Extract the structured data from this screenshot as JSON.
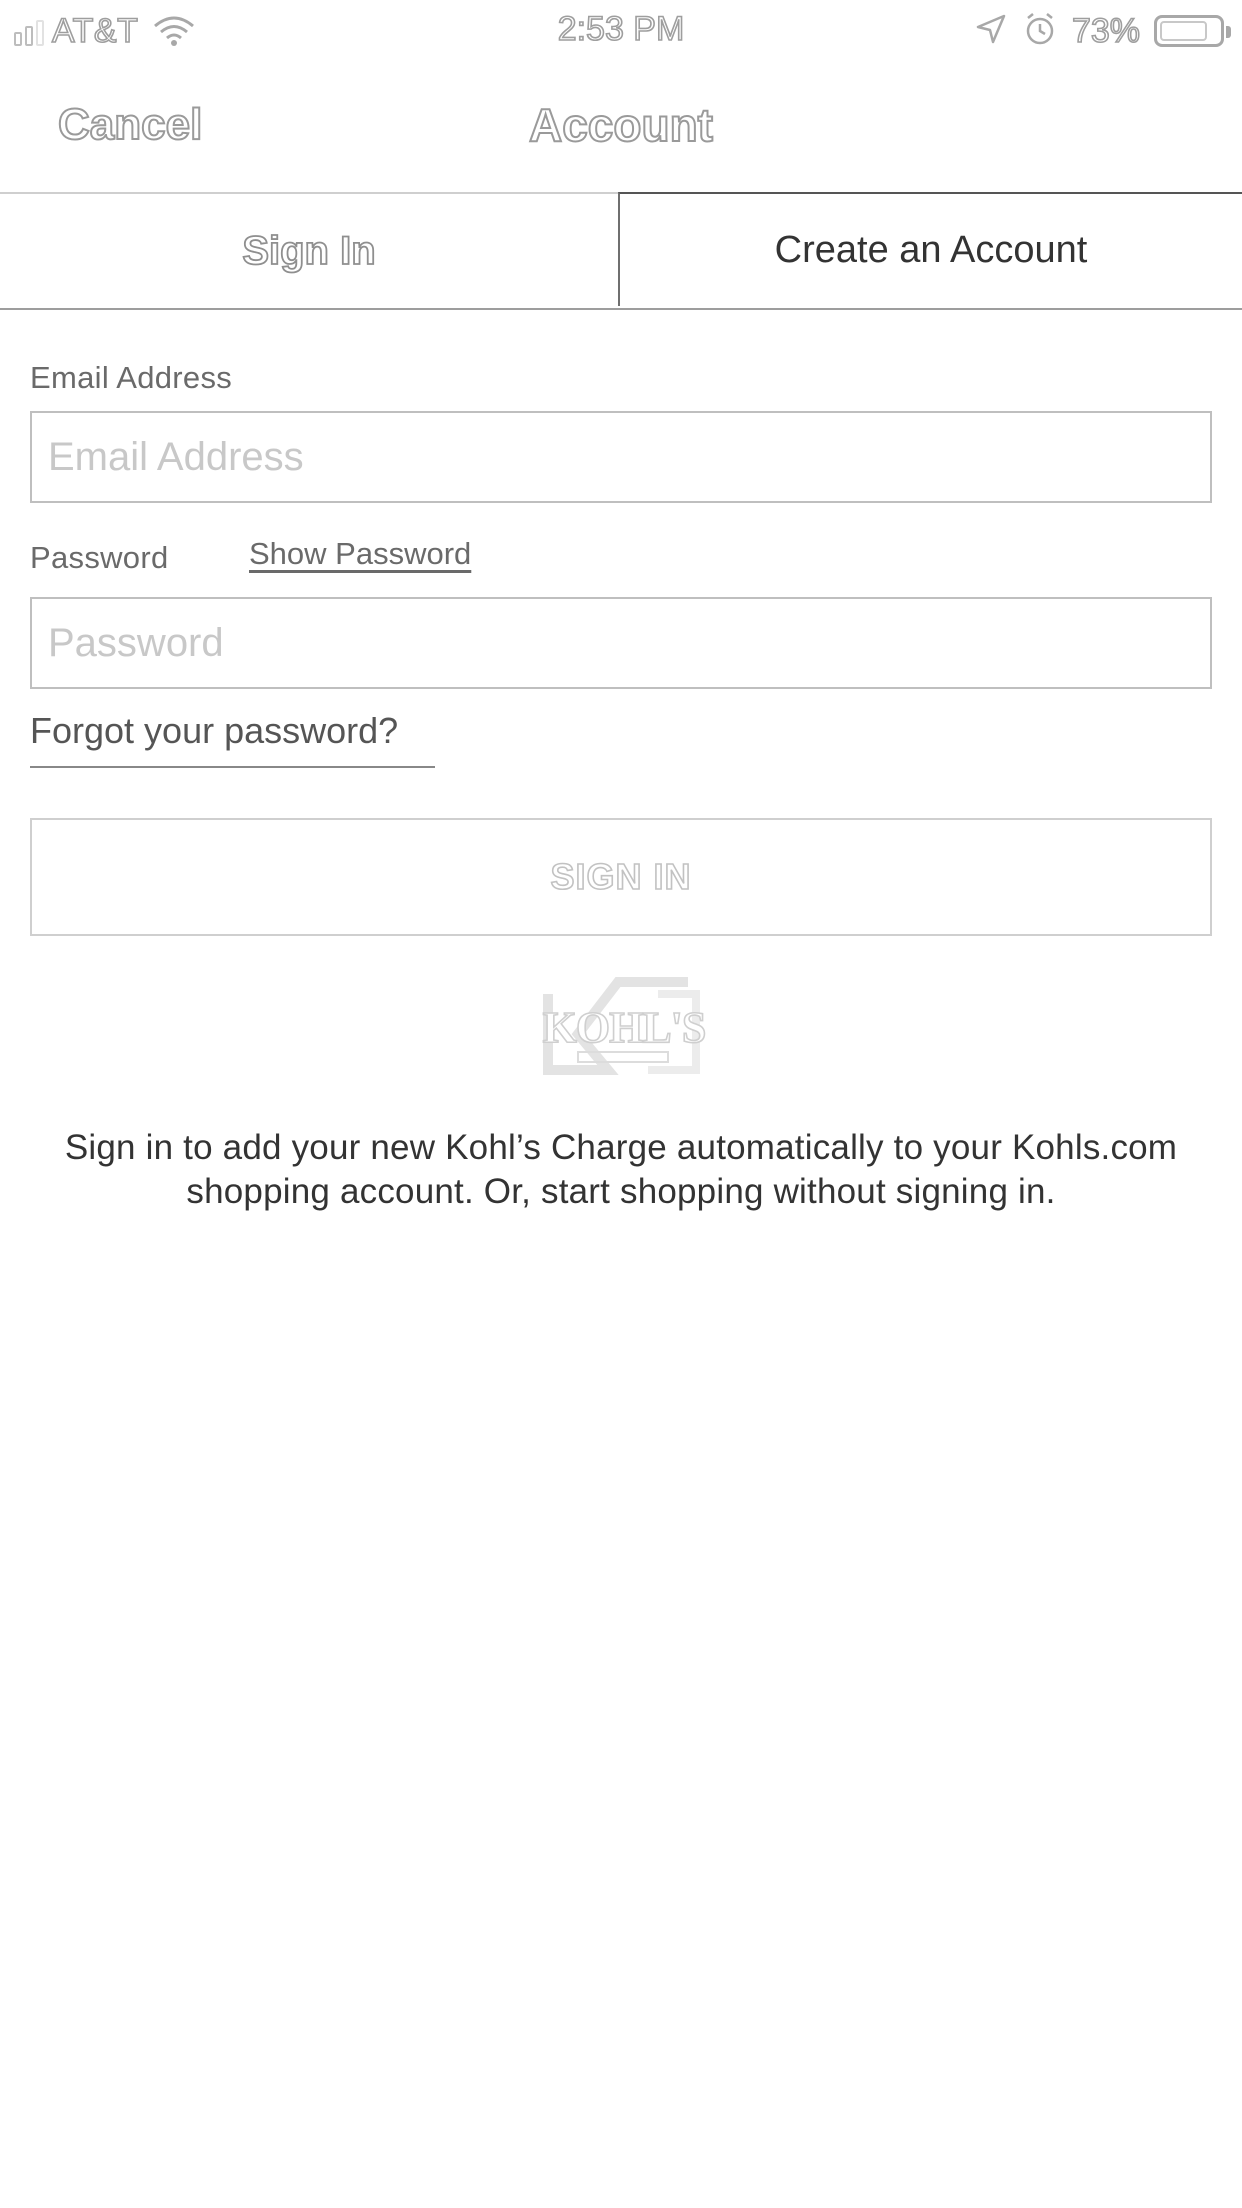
{
  "status_bar": {
    "carrier": "AT&T",
    "time": "2:53 PM",
    "battery": "73%",
    "icons": [
      "signal-icon",
      "wifi-icon",
      "location-icon",
      "alarm-icon",
      "battery-icon"
    ]
  },
  "nav": {
    "cancel_label": "Cancel",
    "title": "Account"
  },
  "tabs": {
    "sign_in": "Sign In",
    "create_account": "Create an Account",
    "selected": "create_account"
  },
  "form": {
    "email_label": "Email Address",
    "email_placeholder": "Email Address",
    "email_value": "",
    "password_label": "Password",
    "show_password_label": "Show Password",
    "password_placeholder": "Password",
    "password_value": "",
    "forgot_label": "Forgot your password?",
    "sign_in_button": "SIGN IN"
  },
  "logo": {
    "text": "KOHL'S"
  },
  "info_text": "Sign in to add your new Kohl’s Charge automatically to your Kohls.com shopping account. Or, start shopping without signing in."
}
